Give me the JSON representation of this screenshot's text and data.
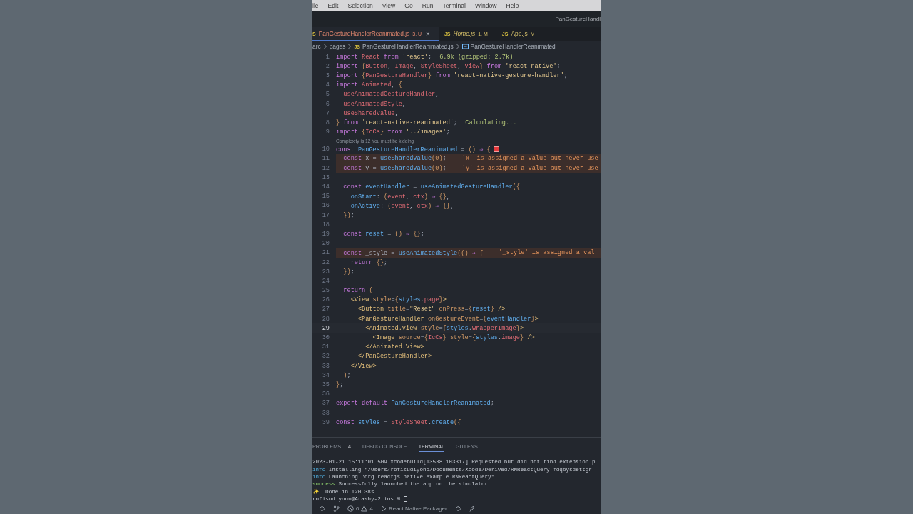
{
  "menu": [
    "ile",
    "Edit",
    "Selection",
    "View",
    "Go",
    "Run",
    "Terminal",
    "Window",
    "Help"
  ],
  "title_bar": {
    "title": "PanGestureHandl"
  },
  "tabs": [
    {
      "icon": "S",
      "label": "PanGestureHandlerReanimated.js",
      "badge": "3, U",
      "kind": "error",
      "preview": false,
      "selected": true,
      "close": "×"
    },
    {
      "icon": "JS",
      "label": "Home.js",
      "badge": "1, M",
      "kind": "modified",
      "preview": true,
      "selected": false
    },
    {
      "icon": "JS",
      "label": "App.js",
      "badge": "M",
      "kind": "modified",
      "preview": false,
      "selected": false
    }
  ],
  "breadcrumb": [
    {
      "kind": "folder",
      "text": "arc"
    },
    {
      "kind": "folder",
      "text": "pages"
    },
    {
      "kind": "file",
      "icon": "JS",
      "text": "PanGestureHandlerReanimated.js"
    },
    {
      "kind": "symbol",
      "text": "PanGestureHandlerReanimated"
    }
  ],
  "editor": {
    "lines": [
      {
        "kind": "code",
        "number": "1",
        "error": false,
        "active": false,
        "tokens": [
          {
            "kind": "keyword",
            "text": "import"
          },
          {
            "kind": "variable",
            "text": " React"
          },
          {
            "kind": "keyword",
            "text": " from"
          },
          {
            "kind": "string",
            "text": " 'react'"
          },
          {
            "kind": "punctuation",
            "text": ";"
          }
        ],
        "hint": {
          "kind": "size",
          "text": "6.9k (gzipped: 2.7k)"
        }
      },
      {
        "kind": "code",
        "number": "2",
        "error": false,
        "active": false,
        "tokens": [
          {
            "kind": "keyword",
            "text": "import"
          },
          {
            "kind": "bracket",
            "text": " {"
          },
          {
            "kind": "variable",
            "text": "Button"
          },
          {
            "kind": "punctuation",
            "text": ", "
          },
          {
            "kind": "variable",
            "text": "Image"
          },
          {
            "kind": "punctuation",
            "text": ", "
          },
          {
            "kind": "variable",
            "text": "StyleSheet"
          },
          {
            "kind": "punctuation",
            "text": ", "
          },
          {
            "kind": "variable",
            "text": "View"
          },
          {
            "kind": "bracket",
            "text": "}"
          },
          {
            "kind": "keyword",
            "text": " from"
          },
          {
            "kind": "string",
            "text": " 'react-native'"
          },
          {
            "kind": "punctuation",
            "text": ";"
          }
        ]
      },
      {
        "kind": "code",
        "number": "3",
        "error": false,
        "active": false,
        "tokens": [
          {
            "kind": "keyword",
            "text": "import"
          },
          {
            "kind": "bracket",
            "text": " {"
          },
          {
            "kind": "variable",
            "text": "PanGestureHandler"
          },
          {
            "kind": "bracket",
            "text": "}"
          },
          {
            "kind": "keyword",
            "text": " from"
          },
          {
            "kind": "string",
            "text": " 'react-native-gesture-handler'"
          },
          {
            "kind": "punctuation",
            "text": ";"
          }
        ]
      },
      {
        "kind": "code",
        "number": "4",
        "error": false,
        "active": false,
        "tokens": [
          {
            "kind": "keyword",
            "text": "import"
          },
          {
            "kind": "variable",
            "text": " Animated"
          },
          {
            "kind": "punctuation",
            "text": ", "
          },
          {
            "kind": "bracket",
            "text": "{"
          }
        ]
      },
      {
        "kind": "code",
        "number": "5",
        "error": false,
        "active": false,
        "tokens": [
          {
            "kind": "variable",
            "text": "  useAnimatedGestureHandler"
          },
          {
            "kind": "punctuation",
            "text": ","
          }
        ]
      },
      {
        "kind": "code",
        "number": "6",
        "error": false,
        "active": false,
        "tokens": [
          {
            "kind": "variable",
            "text": "  useAnimatedStyle"
          },
          {
            "kind": "punctuation",
            "text": ","
          }
        ]
      },
      {
        "kind": "code",
        "number": "7",
        "error": false,
        "active": false,
        "tokens": [
          {
            "kind": "variable",
            "text": "  useSharedValue"
          },
          {
            "kind": "punctuation",
            "text": ","
          }
        ]
      },
      {
        "kind": "code",
        "number": "8",
        "error": false,
        "active": false,
        "tokens": [
          {
            "kind": "bracket",
            "text": "}"
          },
          {
            "kind": "keyword",
            "text": " from"
          },
          {
            "kind": "string",
            "text": " 'react-native-reanimated'"
          },
          {
            "kind": "punctuation",
            "text": ";"
          }
        ],
        "hint": {
          "kind": "size",
          "text": "Calculating..."
        }
      },
      {
        "kind": "code",
        "number": "9",
        "error": false,
        "active": false,
        "tokens": [
          {
            "kind": "keyword",
            "text": "import"
          },
          {
            "kind": "bracket",
            "text": " {"
          },
          {
            "kind": "variable",
            "text": "IcCs"
          },
          {
            "kind": "bracket",
            "text": "}"
          },
          {
            "kind": "keyword",
            "text": " from"
          },
          {
            "kind": "string",
            "text": " '../images'"
          },
          {
            "kind": "punctuation",
            "text": ";"
          }
        ]
      },
      {
        "kind": "codelens",
        "text": "Complexity is 12 You must be kidding"
      },
      {
        "kind": "code",
        "number": "10",
        "error": false,
        "active": false,
        "marker": true,
        "tokens": [
          {
            "kind": "keyword",
            "text": "const"
          },
          {
            "kind": "function",
            "text": " PanGestureHandlerReanimated"
          },
          {
            "kind": "punctuation",
            "text": " = "
          },
          {
            "kind": "bracket",
            "text": "()"
          },
          {
            "kind": "keyword",
            "text": " ⇒"
          },
          {
            "kind": "bracket",
            "text": " {"
          }
        ]
      },
      {
        "kind": "code",
        "number": "11",
        "error": true,
        "active": false,
        "tokens": [
          {
            "kind": "keyword",
            "text": "  const"
          },
          {
            "kind": "punctuation",
            "text": " x = "
          },
          {
            "kind": "function",
            "text": "useSharedValue"
          },
          {
            "kind": "bracket",
            "text": "("
          },
          {
            "kind": "number",
            "text": "0"
          },
          {
            "kind": "bracket",
            "text": ")"
          },
          {
            "kind": "punctuation",
            "text": ";"
          }
        ],
        "hint": {
          "kind": "error",
          "text": "'x' is assigned a value but never use"
        }
      },
      {
        "kind": "code",
        "number": "12",
        "error": true,
        "active": false,
        "tokens": [
          {
            "kind": "keyword",
            "text": "  const"
          },
          {
            "kind": "punctuation",
            "text": " y = "
          },
          {
            "kind": "function",
            "text": "useSharedValue"
          },
          {
            "kind": "bracket",
            "text": "("
          },
          {
            "kind": "number",
            "text": "0"
          },
          {
            "kind": "bracket",
            "text": ")"
          },
          {
            "kind": "punctuation",
            "text": ";"
          }
        ],
        "hint": {
          "kind": "error",
          "text": "'y' is assigned a value but never use"
        }
      },
      {
        "kind": "code",
        "number": "13",
        "error": false,
        "active": false
      },
      {
        "kind": "code",
        "number": "14",
        "error": false,
        "active": false,
        "tokens": [
          {
            "kind": "keyword",
            "text": "  const"
          },
          {
            "kind": "function",
            "text": " eventHandler"
          },
          {
            "kind": "punctuation",
            "text": " = "
          },
          {
            "kind": "function",
            "text": "useAnimatedGestureHandler"
          },
          {
            "kind": "bracket",
            "text": "({"
          }
        ]
      },
      {
        "kind": "code",
        "number": "15",
        "error": false,
        "active": false,
        "tokens": [
          {
            "kind": "function",
            "text": "    onStart"
          },
          {
            "kind": "punctuation",
            "text": ": "
          },
          {
            "kind": "bracket",
            "text": "("
          },
          {
            "kind": "variable",
            "text": "event"
          },
          {
            "kind": "punctuation",
            "text": ", "
          },
          {
            "kind": "variable",
            "text": "ctx"
          },
          {
            "kind": "bracket",
            "text": ")"
          },
          {
            "kind": "keyword",
            "text": " ⇒"
          },
          {
            "kind": "bracket",
            "text": " {}"
          },
          {
            "kind": "punctuation",
            "text": ","
          }
        ]
      },
      {
        "kind": "code",
        "number": "16",
        "error": false,
        "active": false,
        "tokens": [
          {
            "kind": "function",
            "text": "    onActive"
          },
          {
            "kind": "punctuation",
            "text": ": "
          },
          {
            "kind": "bracket",
            "text": "("
          },
          {
            "kind": "variable",
            "text": "event"
          },
          {
            "kind": "punctuation",
            "text": ", "
          },
          {
            "kind": "variable",
            "text": "ctx"
          },
          {
            "kind": "bracket",
            "text": ")"
          },
          {
            "kind": "keyword",
            "text": " ⇒"
          },
          {
            "kind": "bracket",
            "text": " {}"
          },
          {
            "kind": "punctuation",
            "text": ","
          }
        ]
      },
      {
        "kind": "code",
        "number": "17",
        "error": false,
        "active": false,
        "tokens": [
          {
            "kind": "bracket",
            "text": "  })"
          },
          {
            "kind": "punctuation",
            "text": ";"
          }
        ]
      },
      {
        "kind": "code",
        "number": "18",
        "error": false,
        "active": false
      },
      {
        "kind": "code",
        "number": "19",
        "error": false,
        "active": false,
        "tokens": [
          {
            "kind": "keyword",
            "text": "  const"
          },
          {
            "kind": "function",
            "text": " reset"
          },
          {
            "kind": "punctuation",
            "text": " = "
          },
          {
            "kind": "bracket",
            "text": "()"
          },
          {
            "kind": "keyword",
            "text": " ⇒"
          },
          {
            "kind": "bracket",
            "text": " {}"
          },
          {
            "kind": "punctuation",
            "text": ";"
          }
        ]
      },
      {
        "kind": "code",
        "number": "20",
        "error": false,
        "active": false
      },
      {
        "kind": "code",
        "number": "21",
        "error": true,
        "active": false,
        "tokens": [
          {
            "kind": "keyword",
            "text": "  const"
          },
          {
            "kind": "punctuation",
            "text": " _style = "
          },
          {
            "kind": "function",
            "text": "useAnimatedStyle"
          },
          {
            "kind": "bracket",
            "text": "(()"
          },
          {
            "kind": "keyword",
            "text": " ⇒"
          },
          {
            "kind": "bracket",
            "text": " {"
          }
        ],
        "hint": {
          "kind": "error",
          "text": "'_style' is assigned a val"
        }
      },
      {
        "kind": "code",
        "number": "22",
        "error": false,
        "active": false,
        "tokens": [
          {
            "kind": "keyword",
            "text": "    return"
          },
          {
            "kind": "bracket",
            "text": " {}"
          },
          {
            "kind": "punctuation",
            "text": ";"
          }
        ]
      },
      {
        "kind": "code",
        "number": "23",
        "error": false,
        "active": false,
        "tokens": [
          {
            "kind": "bracket",
            "text": "  })"
          },
          {
            "kind": "punctuation",
            "text": ";"
          }
        ]
      },
      {
        "kind": "code",
        "number": "24",
        "error": false,
        "active": false
      },
      {
        "kind": "code",
        "number": "25",
        "error": false,
        "active": false,
        "tokens": [
          {
            "kind": "keyword",
            "text": "  return"
          },
          {
            "kind": "bracket",
            "text": " ("
          }
        ]
      },
      {
        "kind": "code",
        "number": "26",
        "error": false,
        "active": false,
        "tokens": [
          {
            "kind": "tag",
            "text": "    <View"
          },
          {
            "kind": "attribute",
            "text": " style"
          },
          {
            "kind": "punctuation",
            "text": "="
          },
          {
            "kind": "bracket",
            "text": "{"
          },
          {
            "kind": "function",
            "text": "styles"
          },
          {
            "kind": "punctuation",
            "text": "."
          },
          {
            "kind": "variable",
            "text": "page"
          },
          {
            "kind": "bracket",
            "text": "}"
          },
          {
            "kind": "tag",
            "text": ">"
          }
        ]
      },
      {
        "kind": "code",
        "number": "27",
        "error": false,
        "active": false,
        "tokens": [
          {
            "kind": "tag",
            "text": "      <Button"
          },
          {
            "kind": "attribute",
            "text": " title"
          },
          {
            "kind": "punctuation",
            "text": "="
          },
          {
            "kind": "string",
            "text": "\"Reset\""
          },
          {
            "kind": "attribute",
            "text": " onPress"
          },
          {
            "kind": "punctuation",
            "text": "="
          },
          {
            "kind": "bracket",
            "text": "{"
          },
          {
            "kind": "function",
            "text": "reset"
          },
          {
            "kind": "bracket",
            "text": "}"
          },
          {
            "kind": "tag",
            "text": " />"
          }
        ]
      },
      {
        "kind": "code",
        "number": "28",
        "error": false,
        "active": false,
        "tokens": [
          {
            "kind": "tag",
            "text": "      <PanGestureHandler"
          },
          {
            "kind": "attribute",
            "text": " onGestureEvent"
          },
          {
            "kind": "punctuation",
            "text": "="
          },
          {
            "kind": "bracket",
            "text": "{"
          },
          {
            "kind": "function",
            "text": "eventHandler"
          },
          {
            "kind": "bracket",
            "text": "}"
          },
          {
            "kind": "tag",
            "text": ">"
          }
        ]
      },
      {
        "kind": "code",
        "number": "29",
        "error": false,
        "active": true,
        "tokens": [
          {
            "kind": "tag",
            "text": "        <Animated.View"
          },
          {
            "kind": "attribute",
            "text": " style"
          },
          {
            "kind": "punctuation",
            "text": "="
          },
          {
            "kind": "bracket",
            "text": "{"
          },
          {
            "kind": "function",
            "text": "styles"
          },
          {
            "kind": "punctuation",
            "text": "."
          },
          {
            "kind": "variable",
            "text": "wrapperImage"
          },
          {
            "kind": "bracket",
            "text": "}"
          },
          {
            "kind": "tag",
            "text": ">"
          }
        ]
      },
      {
        "kind": "code",
        "number": "30",
        "error": false,
        "active": false,
        "tokens": [
          {
            "kind": "tag",
            "text": "          <Image"
          },
          {
            "kind": "attribute",
            "text": " source"
          },
          {
            "kind": "punctuation",
            "text": "="
          },
          {
            "kind": "bracket",
            "text": "{"
          },
          {
            "kind": "variable",
            "text": "IcCs"
          },
          {
            "kind": "bracket",
            "text": "}"
          },
          {
            "kind": "attribute",
            "text": " style"
          },
          {
            "kind": "punctuation",
            "text": "="
          },
          {
            "kind": "bracket",
            "text": "{"
          },
          {
            "kind": "function",
            "text": "styles"
          },
          {
            "kind": "punctuation",
            "text": "."
          },
          {
            "kind": "variable",
            "text": "image"
          },
          {
            "kind": "bracket",
            "text": "}"
          },
          {
            "kind": "tag",
            "text": " />"
          }
        ]
      },
      {
        "kind": "code",
        "number": "31",
        "error": false,
        "active": false,
        "tokens": [
          {
            "kind": "tag",
            "text": "        </Animated.View>"
          }
        ]
      },
      {
        "kind": "code",
        "number": "32",
        "error": false,
        "active": false,
        "tokens": [
          {
            "kind": "tag",
            "text": "      </PanGestureHandler>"
          }
        ]
      },
      {
        "kind": "code",
        "number": "33",
        "error": false,
        "active": false,
        "tokens": [
          {
            "kind": "tag",
            "text": "    </View>"
          }
        ]
      },
      {
        "kind": "code",
        "number": "34",
        "error": false,
        "active": false,
        "tokens": [
          {
            "kind": "bracket",
            "text": "  )"
          },
          {
            "kind": "punctuation",
            "text": ";"
          }
        ]
      },
      {
        "kind": "code",
        "number": "35",
        "error": false,
        "active": false,
        "tokens": [
          {
            "kind": "bracket",
            "text": "}"
          },
          {
            "kind": "punctuation",
            "text": ";"
          }
        ]
      },
      {
        "kind": "code",
        "number": "36",
        "error": false,
        "active": false
      },
      {
        "kind": "code",
        "number": "37",
        "error": false,
        "active": false,
        "tokens": [
          {
            "kind": "keyword",
            "text": "export"
          },
          {
            "kind": "keyword",
            "text": " default"
          },
          {
            "kind": "function",
            "text": " PanGestureHandlerReanimated"
          },
          {
            "kind": "punctuation",
            "text": ";"
          }
        ]
      },
      {
        "kind": "code",
        "number": "38",
        "error": false,
        "active": false
      },
      {
        "kind": "code",
        "number": "39",
        "error": false,
        "active": false,
        "tokens": [
          {
            "kind": "keyword",
            "text": "const"
          },
          {
            "kind": "function",
            "text": " styles"
          },
          {
            "kind": "punctuation",
            "text": " = "
          },
          {
            "kind": "variable",
            "text": "StyleSheet"
          },
          {
            "kind": "punctuation",
            "text": "."
          },
          {
            "kind": "function",
            "text": "create"
          },
          {
            "kind": "bracket",
            "text": "({"
          }
        ]
      }
    ]
  },
  "panel": {
    "tabs": [
      {
        "label": "PROBLEMS",
        "count": "4",
        "selected": false
      },
      {
        "label": "DEBUG CONSOLE",
        "selected": false
      },
      {
        "label": "TERMINAL",
        "selected": true
      },
      {
        "label": "GITLENS",
        "selected": false
      }
    ],
    "terminal": [
      {
        "kind": "plain",
        "text": "2023-01-21 15:11:01.509 xcodebuild[13538:103317] Requested but did not find extension p"
      },
      {
        "kind": "info",
        "tag": "info",
        "text": "Installing \"/Users/rofisudiyono/Documents/Xcode/Derived/RNReactQuery-fdqbysdettgr"
      },
      {
        "kind": "info",
        "tag": "info",
        "text": "Launching \"org.reactjs.native.example.RNReactQuery\""
      },
      {
        "kind": "success",
        "tag": "success",
        "text": "Successfully launched the app on the simulator"
      },
      {
        "kind": "plain",
        "text": "✨  Done in 120.38s."
      },
      {
        "kind": "prompt",
        "text": "rofisudiyono@Arashy-2 ios %"
      }
    ]
  },
  "status_bar": {
    "errors": "0",
    "warnings": "4",
    "task": "React Native Packager"
  }
}
